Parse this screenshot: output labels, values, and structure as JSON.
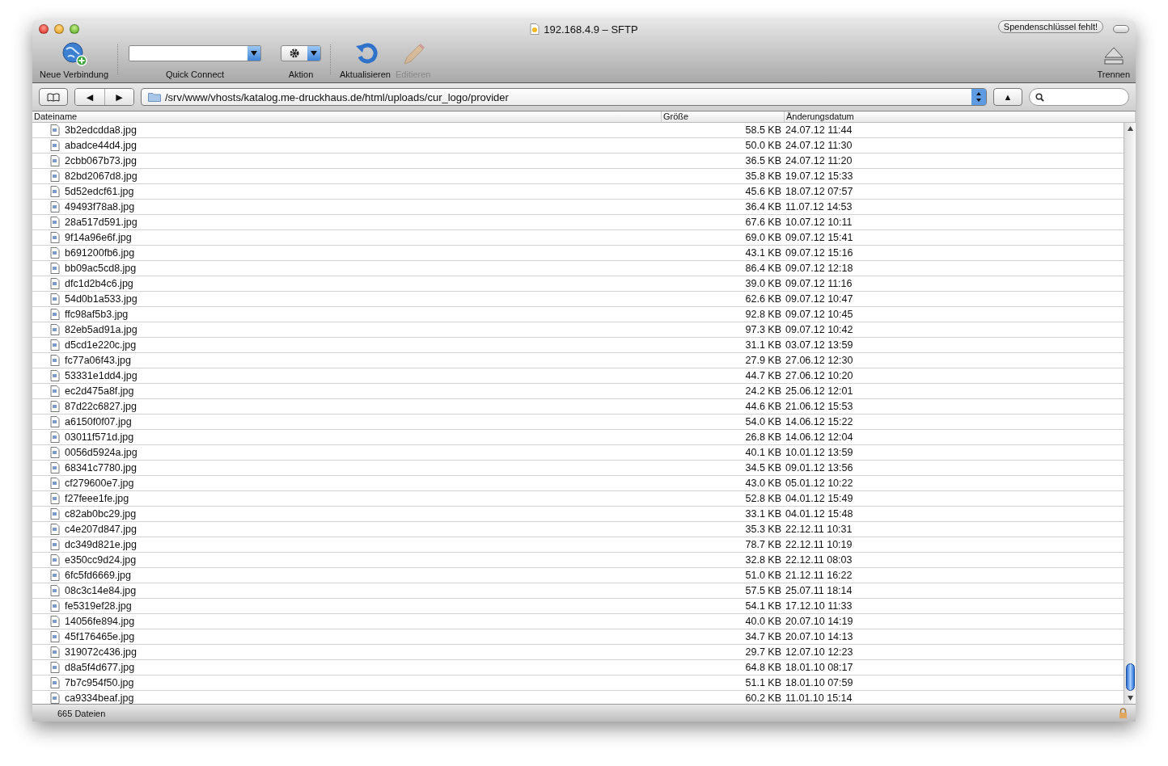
{
  "window": {
    "title": "192.168.4.9 – SFTP",
    "badge": "Spendenschlüssel fehlt!"
  },
  "toolbar": [
    {
      "kind": "new-connection",
      "label": "Neue Verbindung",
      "disabled": false
    },
    {
      "kind": "quick-connect",
      "label": "Quick Connect",
      "disabled": false
    },
    {
      "kind": "action",
      "label": "Aktion",
      "disabled": false
    },
    {
      "kind": "refresh",
      "label": "Aktualisieren",
      "disabled": false
    },
    {
      "kind": "edit",
      "label": "Editieren",
      "disabled": true
    },
    {
      "kind": "disconnect",
      "label": "Trennen",
      "disabled": false
    }
  ],
  "path_bar": {
    "back": "◀",
    "forward": "▶",
    "up": "▲",
    "path": "/srv/www/vhosts/katalog.me-druckhaus.de/html/uploads/cur_logo/provider"
  },
  "table": {
    "columns": [
      "Dateiname",
      "Größe",
      "Änderungsdatum"
    ],
    "rows": [
      [
        "3b2edcdda8.jpg",
        "58.5 KB",
        "24.07.12 11:44"
      ],
      [
        "abadce44d4.jpg",
        "50.0 KB",
        "24.07.12 11:30"
      ],
      [
        "2cbb067b73.jpg",
        "36.5 KB",
        "24.07.12 11:20"
      ],
      [
        "82bd2067d8.jpg",
        "35.8 KB",
        "19.07.12 15:33"
      ],
      [
        "5d52edcf61.jpg",
        "45.6 KB",
        "18.07.12 07:57"
      ],
      [
        "49493f78a8.jpg",
        "36.4 KB",
        "11.07.12 14:53"
      ],
      [
        "28a517d591.jpg",
        "67.6 KB",
        "10.07.12 10:11"
      ],
      [
        "9f14a96e6f.jpg",
        "69.0 KB",
        "09.07.12 15:41"
      ],
      [
        "b691200fb6.jpg",
        "43.1 KB",
        "09.07.12 15:16"
      ],
      [
        "bb09ac5cd8.jpg",
        "86.4 KB",
        "09.07.12 12:18"
      ],
      [
        "dfc1d2b4c6.jpg",
        "39.0 KB",
        "09.07.12 11:16"
      ],
      [
        "54d0b1a533.jpg",
        "62.6 KB",
        "09.07.12 10:47"
      ],
      [
        "ffc98af5b3.jpg",
        "92.8 KB",
        "09.07.12 10:45"
      ],
      [
        "82eb5ad91a.jpg",
        "97.3 KB",
        "09.07.12 10:42"
      ],
      [
        "d5cd1e220c.jpg",
        "31.1 KB",
        "03.07.12 13:59"
      ],
      [
        "fc77a06f43.jpg",
        "27.9 KB",
        "27.06.12 12:30"
      ],
      [
        "53331e1dd4.jpg",
        "44.7 KB",
        "27.06.12 10:20"
      ],
      [
        "ec2d475a8f.jpg",
        "24.2 KB",
        "25.06.12 12:01"
      ],
      [
        "87d22c6827.jpg",
        "44.6 KB",
        "21.06.12 15:53"
      ],
      [
        "a6150f0f07.jpg",
        "54.0 KB",
        "14.06.12 15:22"
      ],
      [
        "03011f571d.jpg",
        "26.8 KB",
        "14.06.12 12:04"
      ],
      [
        "0056d5924a.jpg",
        "40.1 KB",
        "10.01.12 13:59"
      ],
      [
        "68341c7780.jpg",
        "34.5 KB",
        "09.01.12 13:56"
      ],
      [
        "cf279600e7.jpg",
        "43.0 KB",
        "05.01.12 10:22"
      ],
      [
        "f27feee1fe.jpg",
        "52.8 KB",
        "04.01.12 15:49"
      ],
      [
        "c82ab0bc29.jpg",
        "33.1 KB",
        "04.01.12 15:48"
      ],
      [
        "c4e207d847.jpg",
        "35.3 KB",
        "22.12.11 10:31"
      ],
      [
        "dc349d821e.jpg",
        "78.7 KB",
        "22.12.11 10:19"
      ],
      [
        "e350cc9d24.jpg",
        "32.8 KB",
        "22.12.11 08:03"
      ],
      [
        "6fc5fd6669.jpg",
        "51.0 KB",
        "21.12.11 16:22"
      ],
      [
        "08c3c14e84.jpg",
        "57.5 KB",
        "25.07.11 18:14"
      ],
      [
        "fe5319ef28.jpg",
        "54.1 KB",
        "17.12.10 11:33"
      ],
      [
        "14056fe894.jpg",
        "40.0 KB",
        "20.07.10 14:19"
      ],
      [
        "45f176465e.jpg",
        "34.7 KB",
        "20.07.10 14:13"
      ],
      [
        "319072c436.jpg",
        "29.7 KB",
        "12.07.10 12:23"
      ],
      [
        "d8a5f4d677.jpg",
        "64.8 KB",
        "18.01.10 08:17"
      ],
      [
        "7b7c954f50.jpg",
        "51.1 KB",
        "18.01.10 07:59"
      ],
      [
        "ca9334beaf.jpg",
        "60.2 KB",
        "11.01.10 15:14"
      ]
    ]
  },
  "status_bar": "665 Dateien"
}
